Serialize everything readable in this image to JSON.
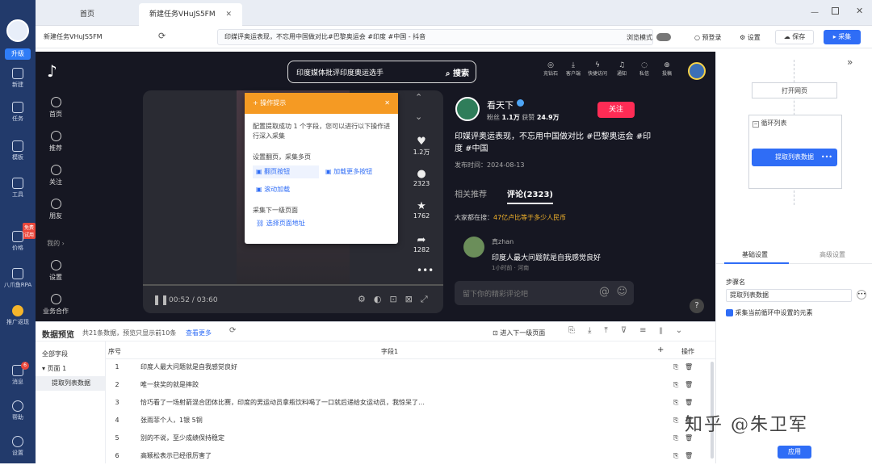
{
  "app": {
    "tabs": [
      "首页",
      "新建任务VHuJS5FM"
    ],
    "task_name": "新建任务VHuJS5FM",
    "url": "印媒评奥运表现，不忘用中国做对比#巴黎奥运会 #印度 #中国 - 抖音",
    "browse_mode_label": "浏览模式",
    "prelogin_label": "预登录",
    "settings_label": "设置",
    "save_label": "保存",
    "collect_label": "采集",
    "upgrade_label": "升级"
  },
  "left_rail": [
    "新建",
    "任务",
    "模板",
    "工具",
    "价格",
    "八爪鱼RPA",
    "推广返现",
    "消息",
    "帮助",
    "设置"
  ],
  "left_rail_badge": "免费试用",
  "messages_badge": "6",
  "tiktok": {
    "search_text": "印度媒体批评印度奥运选手",
    "search_button": "搜索",
    "top_icons": [
      "充钻石",
      "客户端",
      "快捷访问",
      "通知",
      "私信",
      "投稿"
    ],
    "side_nav": [
      "首页",
      "推荐",
      "关注",
      "朋友",
      "我的",
      "设置",
      "业务合作"
    ],
    "author": "看天下",
    "fans_label": "粉丝",
    "fans": "1.1万",
    "likes_label": "获赞",
    "likes": "24.9万",
    "follow_button": "关注",
    "desc": "印媒评奥运表现，不忘用中国做对比 #巴黎奥运会 #印度 #中国",
    "publish_time": "发布时间：2024-08-13",
    "tab_related": "相关推荐",
    "tab_comments": "评论(2323)",
    "hot_search_prefix": "大家都在搜：",
    "hot_search": "47亿卢比等于多少人民币",
    "commenter": "真zhan",
    "comment_text": "印度人最大问题就是自我感觉良好",
    "comment_meta": "1小时前 · 河南",
    "comment_placeholder": "留下你的精彩评论吧",
    "video_time": "00:52 / 03:60",
    "counts": [
      "1.2万",
      "2323",
      "1762",
      "1282"
    ]
  },
  "popup": {
    "title": "操作提示",
    "intro": "配置提取成功 1 个字段，您可以进行以下操作进行深入采集",
    "section1": "设置翻页，采集多页",
    "opt_page_button": "翻页按钮",
    "opt_load_more": "加载更多按钮",
    "opt_scroll": "滚动加载",
    "section2": "采集下一级页面",
    "opt_select_url": "选择页面地址"
  },
  "workflow": {
    "open_page": "打开网页",
    "loop_list": "循环列表",
    "extract_data": "提取列表数据",
    "tab_basic": "基础设置",
    "tab_advanced": "高级设置",
    "step_name_label": "步骤名",
    "step_name_value": "提取列表数据",
    "checkbox_label": "采集当前循环中设置的元素",
    "apply_button": "应用"
  },
  "data_preview": {
    "title": "数据预览",
    "summary": "共21条数据，预览只显示前10条",
    "view_more": "查看更多",
    "enter_next": "进入下一级页面",
    "all_fields": "全部字段",
    "page1": "页面 1",
    "extract_node": "提取列表数据",
    "col_index": "序号",
    "col_field": "字段1",
    "col_op": "操作",
    "rows": [
      "印度人最大问题就是自我感觉良好",
      "唯一获奖的就是摔跤",
      "恰巧看了一场射箭混合团体比赛，印度的男运动员拿瓶饮料喝了一口就后递给女运动员，我惊呆了…",
      "张雨菲个人，1银 5铜",
      "别的不说，至少成绩保持稳定",
      "高颖松表示已经很厉害了"
    ]
  },
  "watermark": "知乎 @朱卫军"
}
